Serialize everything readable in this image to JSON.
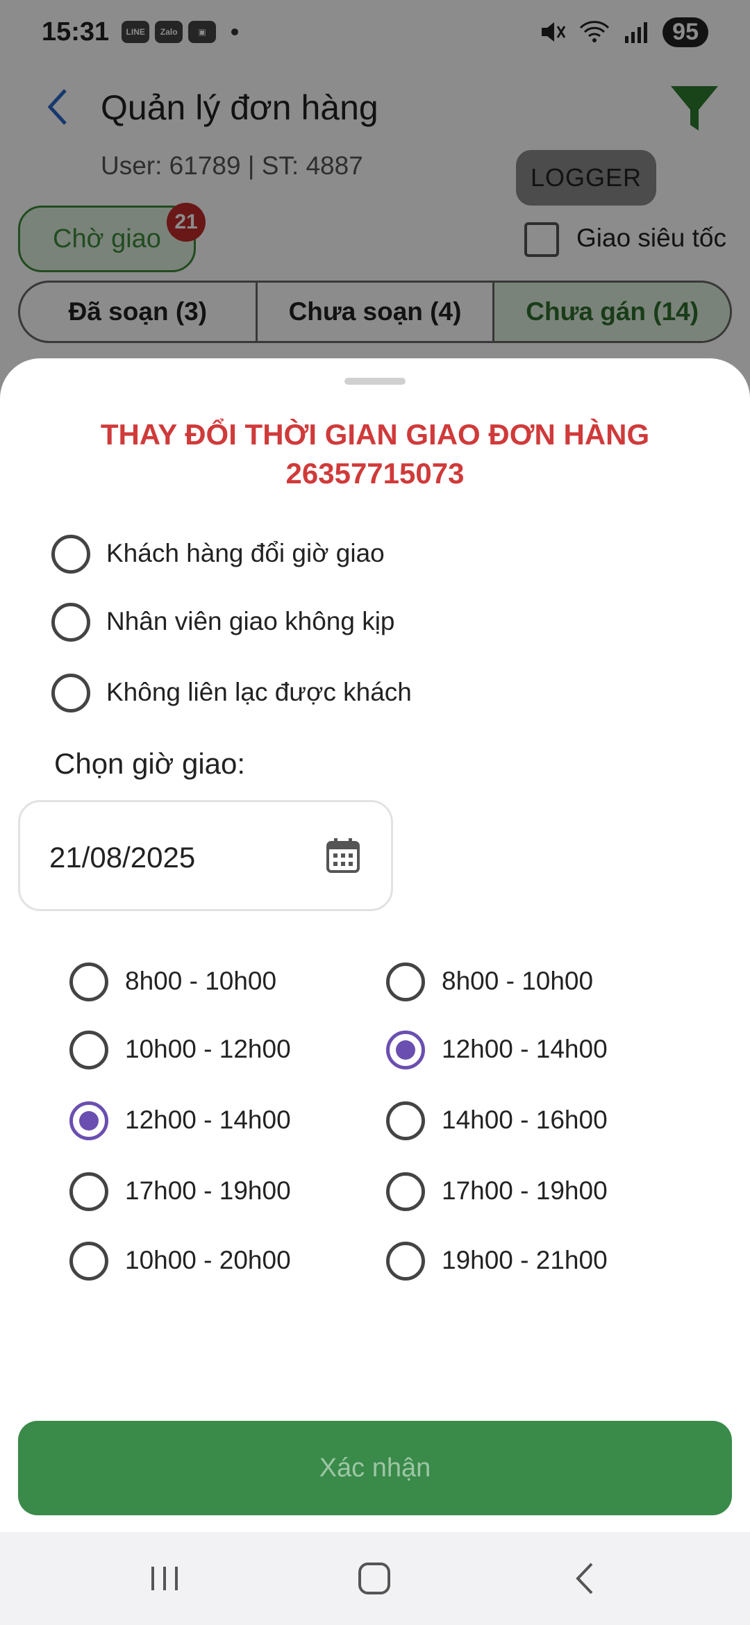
{
  "status_bar": {
    "time": "15:31",
    "app_icons": [
      "LINE",
      "Zalo"
    ],
    "battery": "95",
    "icons": [
      "mute-icon",
      "wifi-icon",
      "signal-icon"
    ]
  },
  "header": {
    "title": "Quản lý đơn hàng",
    "user_info": "User: 61789 | ST: 4887",
    "logger_label": "LOGGER"
  },
  "filters": {
    "status_pill": "Chờ giao",
    "badge_count": "21",
    "express_label": "Giao siêu tốc",
    "tabs": [
      "Đã soạn (3)",
      "Chưa soạn (4)",
      "Chưa gán (14)"
    ]
  },
  "sheet": {
    "title_line1": "THAY ĐỔI THỜI GIAN GIAO ĐƠN HÀNG",
    "title_line2": "26357715073",
    "reasons": [
      "Khách hàng đổi giờ giao",
      "Nhân viên giao không kịp",
      "Không liên lạc được khách"
    ],
    "choose_time_label": "Chọn giờ giao:",
    "date_value": "21/08/2025",
    "slots_left": [
      {
        "label": "8h00 - 10h00",
        "checked": false
      },
      {
        "label": "10h00 - 12h00",
        "checked": false
      },
      {
        "label": "12h00 - 14h00",
        "checked": true
      },
      {
        "label": "17h00 - 19h00",
        "checked": false
      },
      {
        "label": "10h00 - 20h00",
        "checked": false
      }
    ],
    "slots_right": [
      {
        "label": "8h00 - 10h00",
        "checked": false
      },
      {
        "label": "12h00 - 14h00",
        "checked": true
      },
      {
        "label": "14h00 - 16h00",
        "checked": false
      },
      {
        "label": "17h00 - 19h00",
        "checked": false
      },
      {
        "label": "19h00 - 21h00",
        "checked": false
      }
    ],
    "confirm_label": "Xác nhận"
  },
  "colors": {
    "accent_green": "#3a8a4a",
    "title_red": "#d03a3a",
    "radio_purple": "#6a4fb0"
  }
}
